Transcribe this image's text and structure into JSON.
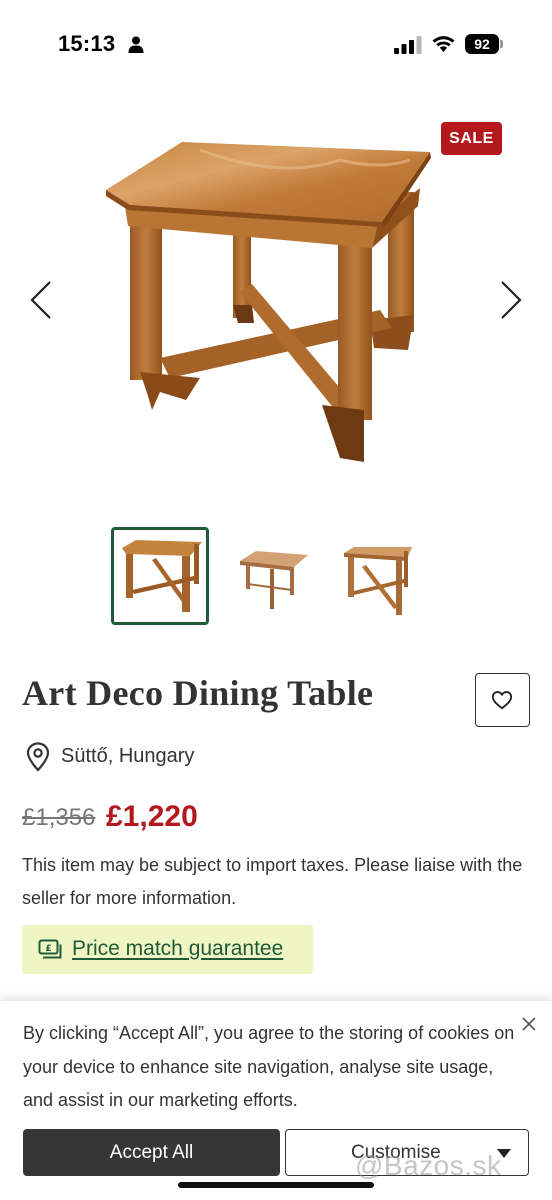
{
  "status_bar": {
    "time": "15:13",
    "battery": "92"
  },
  "product": {
    "badge": "SALE",
    "title": "Art Deco Dining Table",
    "location": "Süttő, Hungary",
    "old_price": "£1,356",
    "price": "£1,220",
    "tax_note": "This item may be subject to import taxes. Please liaise with the seller for more information.",
    "price_match": "Price match guarantee",
    "images": [
      "table-main",
      "table-side",
      "table-angle"
    ],
    "selected_image": 0
  },
  "cookie_banner": {
    "text": "By clicking “Accept All”, you agree to the storing of cookies on your device to enhance site navigation, analyse site usage, and assist in our marketing efforts.",
    "accept_label": "Accept All",
    "customise_label": "Customise"
  },
  "watermark": "@Bazos.sk",
  "colors": {
    "sale": "#b3181d",
    "brand_green": "#1f5a38",
    "price_match_bg": "#f0f5c4"
  }
}
